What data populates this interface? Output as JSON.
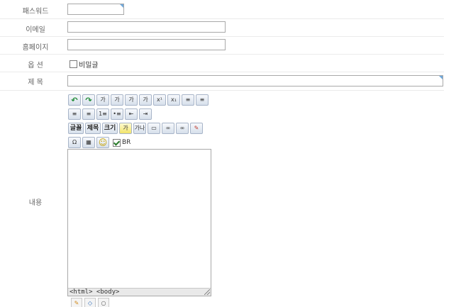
{
  "form": {
    "password_label": "패스워드",
    "email_label": "이메일",
    "homepage_label": "홈페이지",
    "option_label": "옵 션",
    "secret_label": "비밀글",
    "title_label": "제 목",
    "content_label": "내용"
  },
  "toolbar": {
    "row1": [
      {
        "name": "undo-icon",
        "glyph": "↶"
      },
      {
        "name": "redo-icon",
        "glyph": "↷"
      },
      {
        "name": "bold-icon",
        "glyph": "가"
      },
      {
        "name": "underline-icon",
        "glyph": "가"
      },
      {
        "name": "strikethrough-icon",
        "glyph": "가"
      },
      {
        "name": "italic-icon",
        "glyph": "가"
      },
      {
        "name": "superscript-icon",
        "glyph": "x¹"
      },
      {
        "name": "subscript-icon",
        "glyph": "x₁"
      },
      {
        "name": "align-left-icon",
        "glyph": "≡"
      },
      {
        "name": "align-center-icon",
        "glyph": "≡"
      }
    ],
    "row2": [
      {
        "name": "align-right-icon",
        "glyph": "≡"
      },
      {
        "name": "align-justify-icon",
        "glyph": "≡"
      },
      {
        "name": "ordered-list-icon",
        "glyph": "1≡"
      },
      {
        "name": "unordered-list-icon",
        "glyph": "•≡"
      },
      {
        "name": "outdent-icon",
        "glyph": "⇤"
      },
      {
        "name": "indent-icon",
        "glyph": "⇥"
      }
    ],
    "row3": [
      {
        "name": "font-button",
        "label": "글꼴"
      },
      {
        "name": "heading-button",
        "label": "제목"
      },
      {
        "name": "size-button",
        "label": "크기"
      }
    ],
    "row3_icons": [
      {
        "name": "highlight-icon",
        "glyph": "가"
      },
      {
        "name": "font-color-icon",
        "glyph": "가나"
      },
      {
        "name": "image-icon",
        "glyph": "▭"
      },
      {
        "name": "link-icon",
        "glyph": "∞"
      },
      {
        "name": "unlink-icon",
        "glyph": "∞"
      },
      {
        "name": "eraser-icon",
        "glyph": "✎"
      }
    ],
    "row4": [
      {
        "name": "special-char-icon",
        "glyph": "Ω"
      },
      {
        "name": "table-icon",
        "glyph": "▦"
      },
      {
        "name": "emoticon-icon",
        "glyph": "☺"
      }
    ],
    "br_label": "BR"
  },
  "editor": {
    "status_path": "<html> <body>"
  },
  "mode_tabs": [
    {
      "name": "wysiwyg-mode-icon",
      "glyph": "✎"
    },
    {
      "name": "source-mode-icon",
      "glyph": "◇"
    },
    {
      "name": "preview-mode-icon",
      "glyph": "○"
    }
  ]
}
